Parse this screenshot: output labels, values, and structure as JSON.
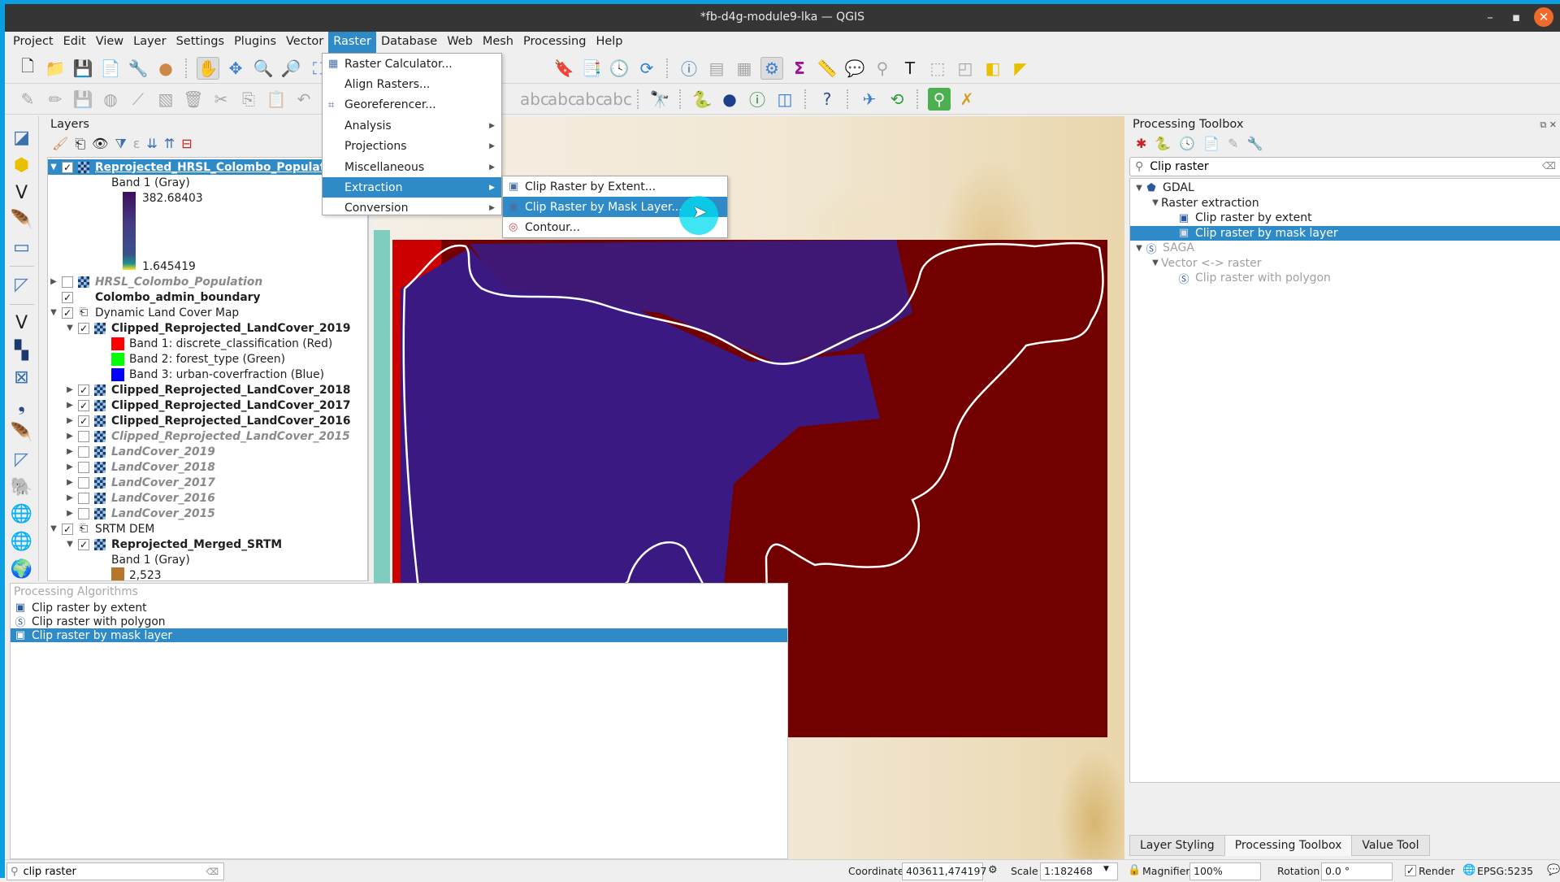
{
  "window": {
    "title": "*fb-d4g-module9-lka — QGIS",
    "controls": {
      "minimize": "–",
      "maximize": "▪",
      "close": "✕"
    }
  },
  "menubar": {
    "items": [
      "Project",
      "Edit",
      "View",
      "Layer",
      "Settings",
      "Plugins",
      "Vector",
      "Raster",
      "Database",
      "Web",
      "Mesh",
      "Processing",
      "Help"
    ],
    "active": "Raster"
  },
  "raster_menu": {
    "items": [
      {
        "label": "Raster Calculator...",
        "icon": "raster-calculator-icon",
        "submenu": false
      },
      {
        "label": "Align Rasters...",
        "icon": "",
        "submenu": false
      },
      {
        "label": "Georeferencer...",
        "icon": "georeferencer-icon",
        "submenu": false
      },
      {
        "label": "Analysis",
        "icon": "",
        "submenu": true
      },
      {
        "label": "Projections",
        "icon": "",
        "submenu": true
      },
      {
        "label": "Miscellaneous",
        "icon": "",
        "submenu": true
      },
      {
        "label": "Extraction",
        "icon": "",
        "submenu": true,
        "highlighted": true
      },
      {
        "label": "Conversion",
        "icon": "",
        "submenu": true
      }
    ]
  },
  "extraction_menu": {
    "items": [
      {
        "label": "Clip Raster by Extent...",
        "icon": "gdal-raster-icon"
      },
      {
        "label": "Clip Raster by Mask Layer...",
        "icon": "gdal-raster-icon",
        "highlighted": true
      },
      {
        "label": "Contour...",
        "icon": "contour-icon"
      }
    ]
  },
  "layers_panel": {
    "title": "Layers",
    "rows": [
      {
        "label": "Reprojected_HRSL_Colombo_Population",
        "checked": true,
        "expanded": true,
        "selected": true,
        "style": "bold",
        "indent": 0,
        "icon": "raster"
      },
      {
        "label": "Band 1 (Gray)",
        "type": "legend-text",
        "indent": 2
      },
      {
        "label": "382.68403",
        "type": "legend-value",
        "indent": 3
      },
      {
        "label": "1.645419",
        "type": "legend-value",
        "indent": 3
      },
      {
        "label": "HRSL_Colombo_Population",
        "checked": false,
        "expanded": false,
        "style": "italic-dim",
        "indent": 0,
        "icon": "raster"
      },
      {
        "label": "Colombo_admin_boundary",
        "checked": true,
        "style": "bold",
        "indent": 0,
        "icon": "polygon"
      },
      {
        "label": "Dynamic Land Cover Map",
        "checked": true,
        "expanded": true,
        "style": "group",
        "indent": 0,
        "icon": "group"
      },
      {
        "label": "Clipped_Reprojected_LandCover_2019",
        "checked": true,
        "expanded": true,
        "style": "bold",
        "indent": 1,
        "icon": "raster"
      },
      {
        "label": "Band 1: discrete_classification (Red)",
        "type": "legend-swatch",
        "color": "#ff0000",
        "indent": 2
      },
      {
        "label": "Band 2: forest_type (Green)",
        "type": "legend-swatch",
        "color": "#00ff00",
        "indent": 2
      },
      {
        "label": "Band 3: urban-coverfraction (Blue)",
        "type": "legend-swatch",
        "color": "#0000ff",
        "indent": 2
      },
      {
        "label": "Clipped_Reprojected_LandCover_2018",
        "checked": true,
        "expanded": false,
        "style": "bold",
        "indent": 1,
        "icon": "raster"
      },
      {
        "label": "Clipped_Reprojected_LandCover_2017",
        "checked": true,
        "expanded": false,
        "style": "bold",
        "indent": 1,
        "icon": "raster"
      },
      {
        "label": "Clipped_Reprojected_LandCover_2016",
        "checked": true,
        "expanded": false,
        "style": "bold",
        "indent": 1,
        "icon": "raster"
      },
      {
        "label": "Clipped_Reprojected_LandCover_2015",
        "checked": false,
        "expanded": false,
        "style": "italic-dim",
        "indent": 1,
        "icon": "raster"
      },
      {
        "label": "LandCover_2019",
        "checked": false,
        "expanded": false,
        "style": "italic-dim",
        "indent": 1,
        "icon": "raster"
      },
      {
        "label": "LandCover_2018",
        "checked": false,
        "expanded": false,
        "style": "italic-dim",
        "indent": 1,
        "icon": "raster"
      },
      {
        "label": "LandCover_2017",
        "checked": false,
        "expanded": false,
        "style": "italic-dim",
        "indent": 1,
        "icon": "raster"
      },
      {
        "label": "LandCover_2016",
        "checked": false,
        "expanded": false,
        "style": "italic-dim",
        "indent": 1,
        "icon": "raster"
      },
      {
        "label": "LandCover_2015",
        "checked": false,
        "expanded": false,
        "style": "italic-dim",
        "indent": 1,
        "icon": "raster"
      },
      {
        "label": "SRTM DEM",
        "checked": true,
        "expanded": true,
        "style": "group",
        "indent": 0,
        "icon": "group"
      },
      {
        "label": "Reprojected_Merged_SRTM",
        "checked": true,
        "expanded": true,
        "style": "bold",
        "indent": 1,
        "icon": "raster"
      },
      {
        "label": "Band 1 (Gray)",
        "type": "legend-text",
        "indent": 2
      },
      {
        "label": "2,523",
        "type": "legend-swatch",
        "color": "#b5762e",
        "indent": 2
      }
    ]
  },
  "locator_results": {
    "header": "Processing Algorithms",
    "items": [
      {
        "label": "Clip raster by extent",
        "icon": "gdal-raster-icon"
      },
      {
        "label": "Clip raster with polygon",
        "icon": "saga-icon"
      },
      {
        "label": "Clip raster by mask layer",
        "icon": "gdal-raster-icon",
        "selected": true
      }
    ]
  },
  "processing_toolbox": {
    "title": "Processing Toolbox",
    "search_value": "Clip raster",
    "tree": [
      {
        "label": "GDAL",
        "indent": 0,
        "expanded": true,
        "icon": "gdal-icon"
      },
      {
        "label": "Raster extraction",
        "indent": 1,
        "expanded": true,
        "icon": ""
      },
      {
        "label": "Clip raster by extent",
        "indent": 2,
        "icon": "gdal-raster-icon"
      },
      {
        "label": "Clip raster by mask layer",
        "indent": 2,
        "icon": "gdal-raster-icon",
        "selected": true
      },
      {
        "label": "SAGA",
        "indent": 0,
        "expanded": true,
        "icon": "saga-icon",
        "dim": true
      },
      {
        "label": "Vector <-> raster",
        "indent": 1,
        "expanded": true,
        "icon": "",
        "dim": true
      },
      {
        "label": "Clip raster with polygon",
        "indent": 2,
        "icon": "saga-icon",
        "dim": true
      }
    ],
    "tabs": [
      {
        "label": "Layer Styling",
        "active": false
      },
      {
        "label": "Processing Toolbox",
        "active": true
      },
      {
        "label": "Value Tool",
        "active": false
      }
    ]
  },
  "statusbar": {
    "locator_value": "clip raster",
    "coordinate_label": "Coordinate",
    "coordinate_value": "403611,474197",
    "scale_label": "Scale",
    "scale_value": "1:182468",
    "magnifier_label": "Magnifier",
    "magnifier_value": "100%",
    "rotation_label": "Rotation",
    "rotation_value": "0.0 °",
    "render_label": "Render",
    "render_checked": true,
    "crs": "EPSG:5235"
  },
  "colors": {
    "accent": "#2e8bc7",
    "titlebar": "#353535",
    "window_border": "#0b9ee0",
    "raster_dark_red": "#730000",
    "raster_purple": "#3a1a82"
  }
}
